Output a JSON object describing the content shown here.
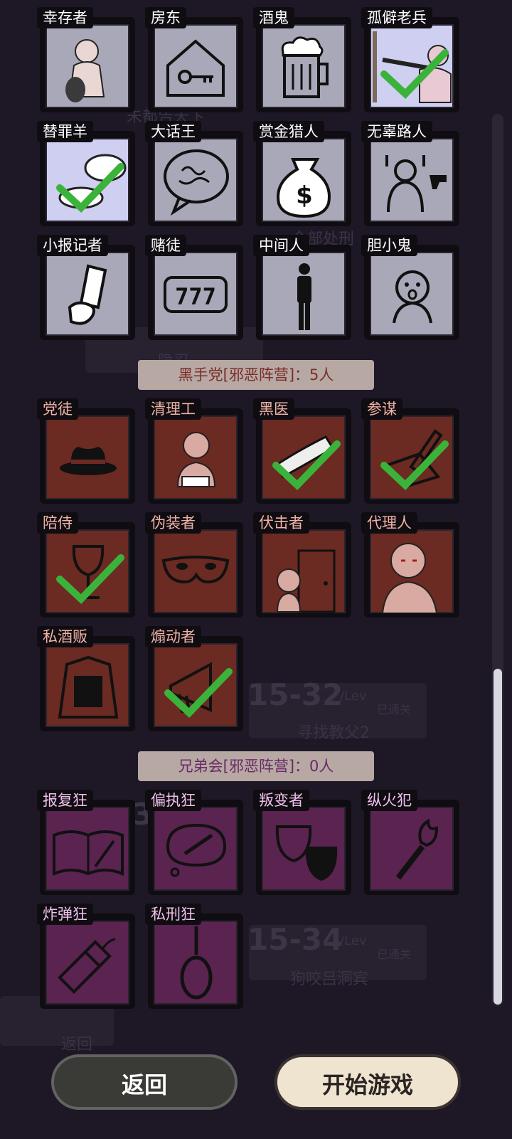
{
  "background": {
    "texts": [
      "未都告天卞",
      "全部处刑",
      "隐忍",
      "寻找教父2",
      "狗咬吕洞宾",
      "已通关",
      "已通关",
      "返回",
      "15-32",
      "15-34",
      "/Lev",
      "/Lev",
      "15-33"
    ]
  },
  "good_roles": [
    {
      "label": "幸存者",
      "icon": "survivor-icon",
      "selected": false
    },
    {
      "label": "房东",
      "icon": "house-key-icon",
      "selected": false
    },
    {
      "label": "酒鬼",
      "icon": "beer-mug-icon",
      "selected": false
    },
    {
      "label": "孤僻老兵",
      "icon": "veteran-icon",
      "selected": true
    },
    {
      "label": "替罪羊",
      "icon": "sheep-icon",
      "selected": true
    },
    {
      "label": "大话王",
      "icon": "speech-bubble-icon",
      "selected": false
    },
    {
      "label": "赏金猎人",
      "icon": "money-bag-icon",
      "selected": false
    },
    {
      "label": "无辜路人",
      "icon": "hostage-icon",
      "selected": false
    },
    {
      "label": "小报记者",
      "icon": "newspaper-icon",
      "selected": false
    },
    {
      "label": "赌徒",
      "icon": "slot-777-icon",
      "selected": false
    },
    {
      "label": "中间人",
      "icon": "person-icon",
      "selected": false
    },
    {
      "label": "胆小鬼",
      "icon": "scared-face-icon",
      "selected": false
    }
  ],
  "black_banner": "黑手党[邪恶阵营]：5人",
  "black_roles": [
    {
      "label": "党徒",
      "icon": "fedora-hat-icon",
      "selected": false
    },
    {
      "label": "清理工",
      "icon": "cleaner-icon",
      "selected": false
    },
    {
      "label": "黑医",
      "icon": "bandaged-arm-icon",
      "selected": true
    },
    {
      "label": "参谋",
      "icon": "pen-paper-icon",
      "selected": true
    },
    {
      "label": "陪侍",
      "icon": "wine-glass-icon",
      "selected": true
    },
    {
      "label": "伪装者",
      "icon": "mask-icon",
      "selected": false
    },
    {
      "label": "伏击者",
      "icon": "ambush-door-icon",
      "selected": false
    },
    {
      "label": "代理人",
      "icon": "thumbs-down-icon",
      "selected": false
    },
    {
      "label": "私酒贩",
      "icon": "coat-bottles-icon",
      "selected": false
    },
    {
      "label": "煽动者",
      "icon": "megaphone-icon",
      "selected": true
    }
  ],
  "bro_banner": "兄弟会[邪恶阵营]：0人",
  "bro_roles": [
    {
      "label": "报复狂",
      "icon": "book-knife-icon",
      "selected": false
    },
    {
      "label": "偏执狂",
      "icon": "thought-knife-icon",
      "selected": false
    },
    {
      "label": "叛变者",
      "icon": "theater-masks-icon",
      "selected": false
    },
    {
      "label": "纵火犯",
      "icon": "torch-icon",
      "selected": false
    },
    {
      "label": "炸弹狂",
      "icon": "dynamite-icon",
      "selected": false
    },
    {
      "label": "私刑狂",
      "icon": "noose-icon",
      "selected": false
    }
  ],
  "buttons": {
    "back": "返回",
    "start": "开始游戏"
  }
}
